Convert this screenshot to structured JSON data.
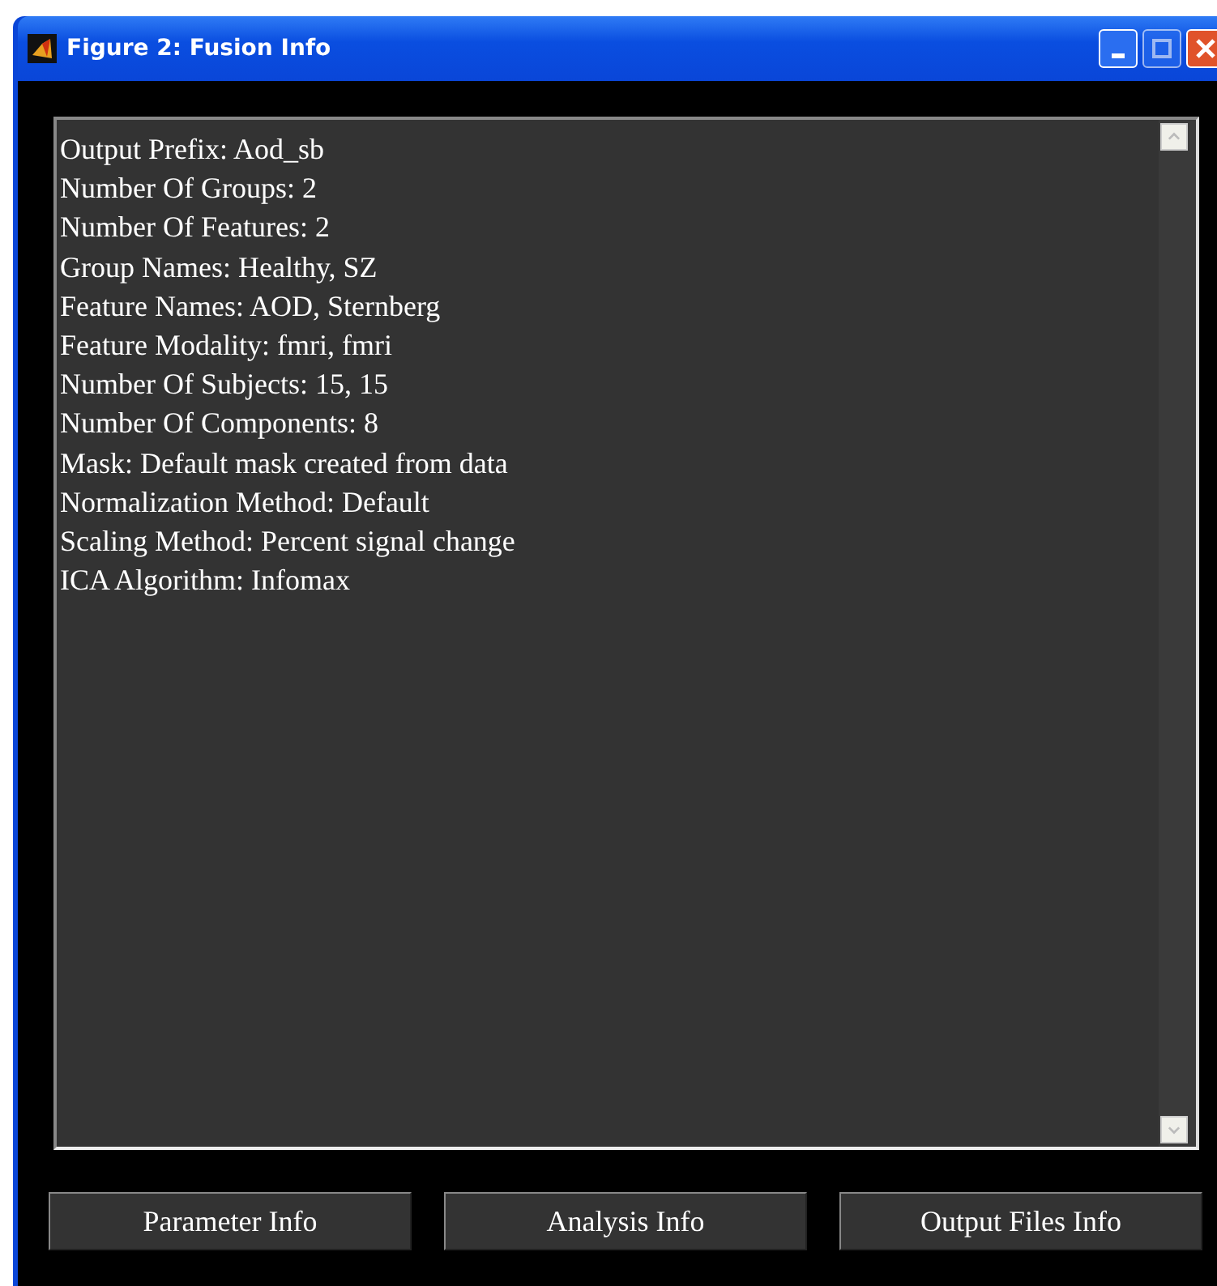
{
  "window": {
    "title": "Figure 2: Fusion Info"
  },
  "info_lines": [
    "Output Prefix: Aod_sb",
    "Number Of Groups: 2",
    "Number Of Features: 2",
    "Group Names: Healthy, SZ",
    "Feature Names: AOD, Sternberg",
    "Feature Modality: fmri, fmri",
    "Number Of Subjects: 15, 15",
    "Number Of Components: 8",
    "Mask: Default mask created from data",
    "Normalization Method: Default",
    "Scaling Method: Percent signal change",
    "ICA Algorithm: Infomax"
  ],
  "buttons": [
    "Parameter Info",
    "Analysis Info",
    "Output Files Info"
  ]
}
